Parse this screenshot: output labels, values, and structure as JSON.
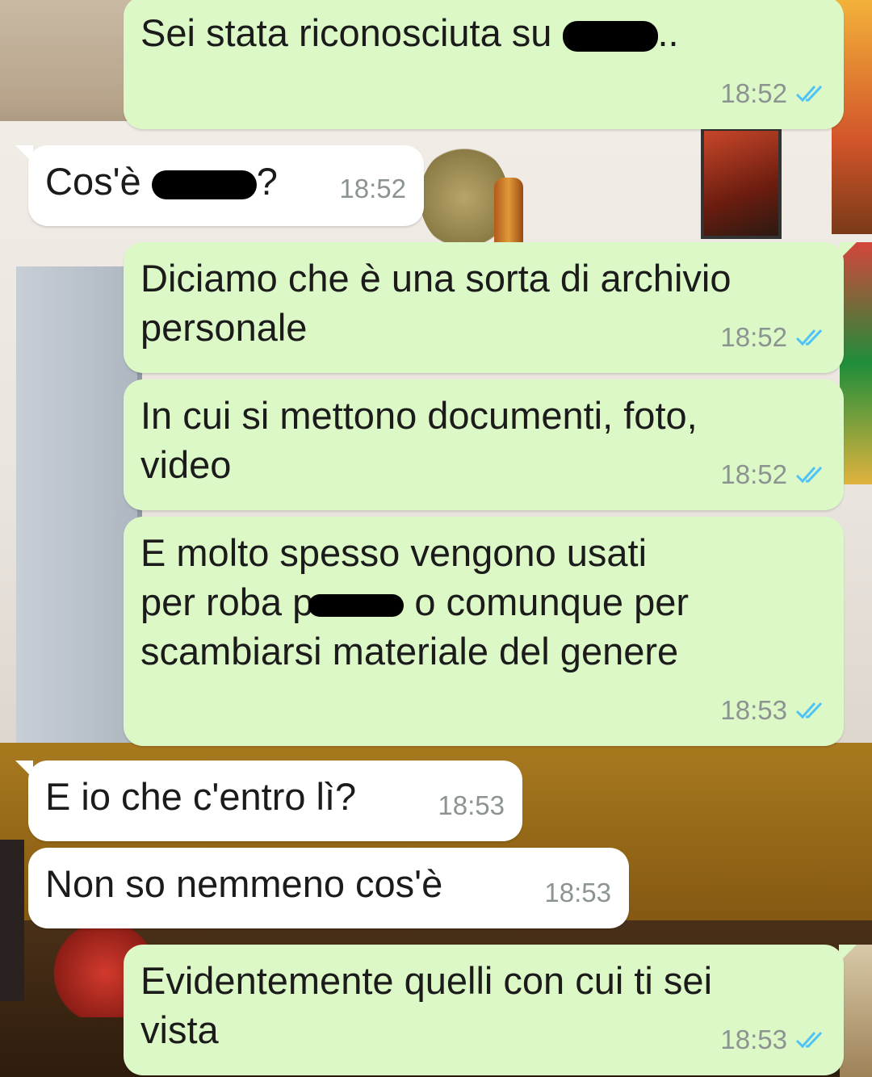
{
  "colors": {
    "outgoing_bubble": "#dcf8c6",
    "incoming_bubble": "#ffffff",
    "timestamp": "#8b9491",
    "read_ticks": "#4fc3f7"
  },
  "messages": [
    {
      "direction": "outgoing",
      "before": "Sei stata riconosciuta su ",
      "redacted": true,
      "after": "..",
      "time": "18:52",
      "status_icon": "double-check-icon"
    },
    {
      "direction": "incoming",
      "before": "Cos'è ",
      "redacted": true,
      "after": "?",
      "time": "18:52"
    },
    {
      "direction": "outgoing",
      "text": "Diciamo che è una sorta di archivio\npersonale",
      "time": "18:52",
      "status_icon": "double-check-icon"
    },
    {
      "direction": "outgoing",
      "text": "In cui si mettono documenti, foto,\nvideo",
      "time": "18:52",
      "status_icon": "double-check-icon"
    },
    {
      "direction": "outgoing",
      "before": "E molto spesso vengono usati\nper roba p",
      "redacted": true,
      "after": " o comunque per\nscambiarsi materiale del genere",
      "time": "18:53",
      "status_icon": "double-check-icon"
    },
    {
      "direction": "incoming",
      "text": "E io che c'entro lì?",
      "time": "18:53"
    },
    {
      "direction": "incoming",
      "text": "Non so nemmeno cos'è",
      "time": "18:53"
    },
    {
      "direction": "outgoing",
      "text": "Evidentemente quelli con cui ti sei\nvista",
      "time": "18:53",
      "status_icon": "double-check-icon"
    }
  ]
}
